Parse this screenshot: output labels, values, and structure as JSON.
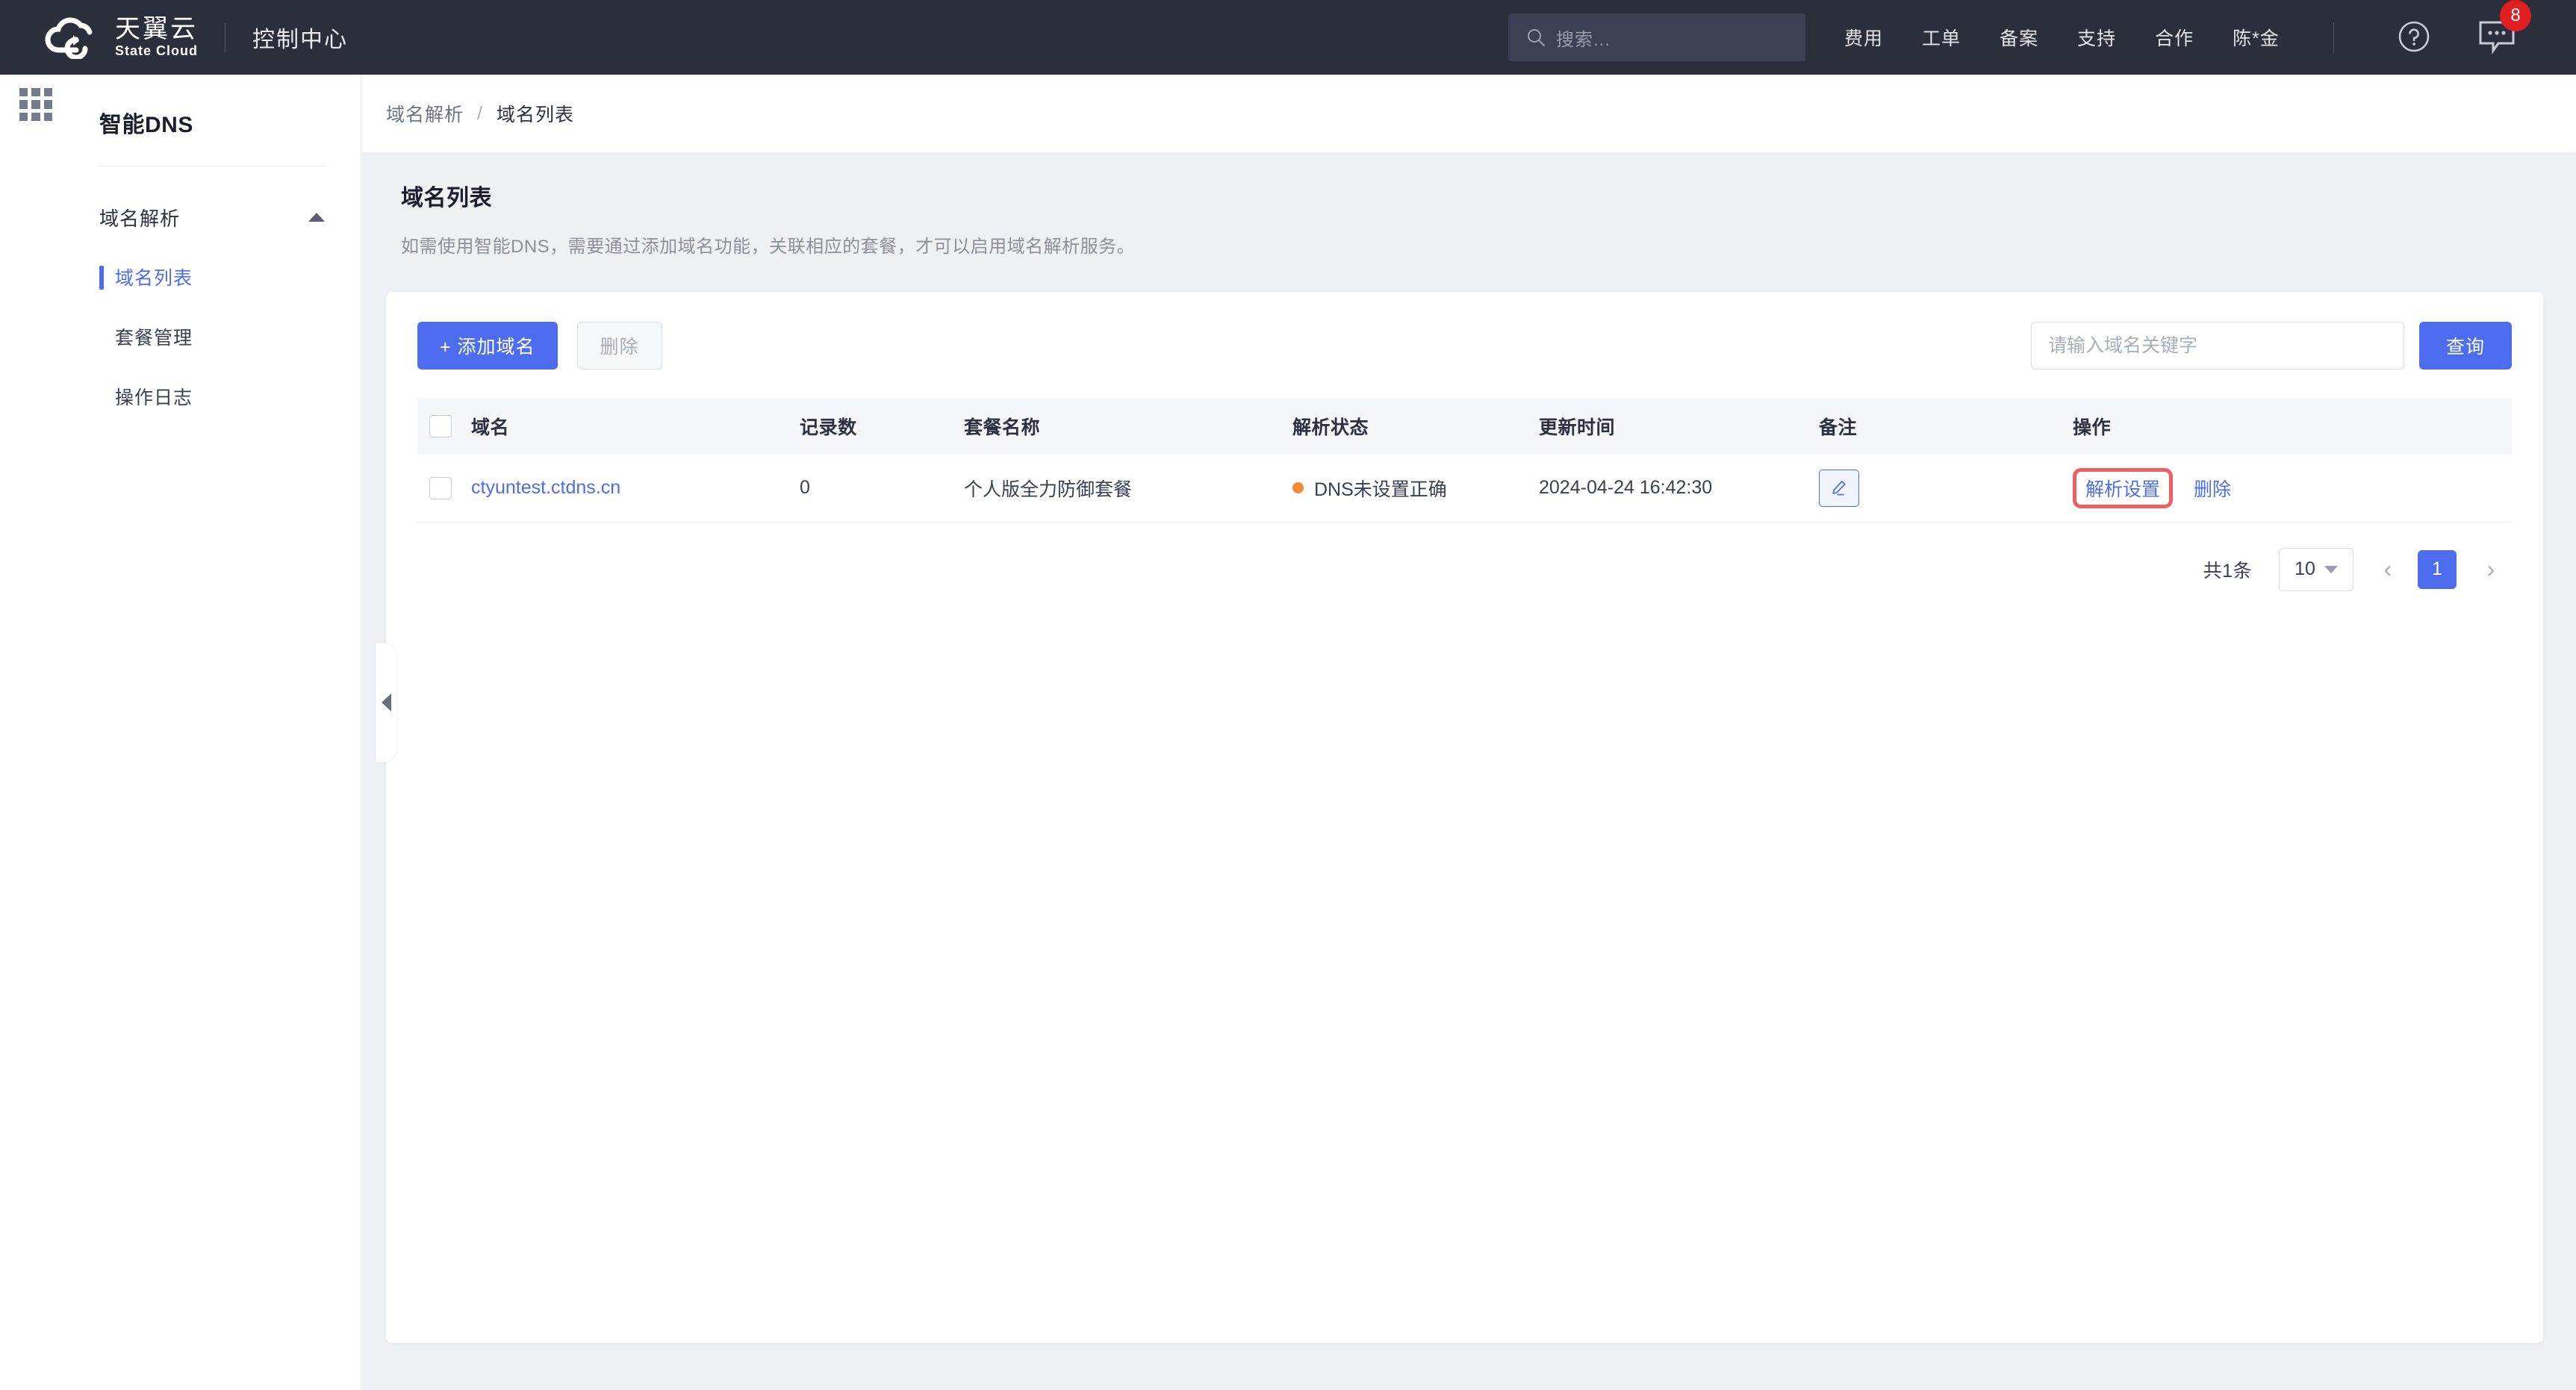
{
  "header": {
    "brand_cn": "天翼云",
    "brand_en": "State Cloud",
    "console_title": "控制中心",
    "search_placeholder": "搜索...",
    "nav": [
      {
        "label": "费用"
      },
      {
        "label": "工单"
      },
      {
        "label": "备案"
      },
      {
        "label": "支持"
      },
      {
        "label": "合作"
      },
      {
        "label": "陈*金"
      }
    ],
    "message_badge": "8"
  },
  "sidebar": {
    "title": "智能DNS",
    "group_label": "域名解析",
    "items": [
      {
        "label": "域名列表",
        "active": true
      },
      {
        "label": "套餐管理",
        "active": false
      },
      {
        "label": "操作日志",
        "active": false
      }
    ]
  },
  "breadcrumb": {
    "parent": "域名解析",
    "separator": "/",
    "current": "域名列表"
  },
  "page": {
    "title": "域名列表",
    "description": "如需使用智能DNS，需要通过添加域名功能，关联相应的套餐，才可以启用域名解析服务。"
  },
  "toolbar": {
    "add_label": "+ 添加域名",
    "delete_label": "删除",
    "search_placeholder": "请输入域名关键字",
    "search_value": "",
    "query_label": "查询"
  },
  "table": {
    "columns": [
      "域名",
      "记录数",
      "套餐名称",
      "解析状态",
      "更新时间",
      "备注",
      "操作"
    ],
    "rows": [
      {
        "domain": "ctyuntest.ctdns.cn",
        "records": "0",
        "package": "个人版全力防御套餐",
        "status": "DNS未设置正确",
        "status_color": "#f08c36",
        "updated": "2024-04-24 16:42:30",
        "note_icon": "pencil-icon",
        "action_primary": "解析设置",
        "action_delete": "删除"
      }
    ]
  },
  "pagination": {
    "total_text": "共1条",
    "page_size": "10",
    "current_page": "1",
    "prev_glyph": "‹",
    "next_glyph": "›"
  },
  "colors": {
    "accent": "#4d6cf0",
    "header_bg": "#2b2e3b",
    "page_bg": "#eef0f4",
    "badge_red": "#e02020",
    "highlight_red": "#ee5f5f",
    "status_orange": "#f08c36"
  }
}
